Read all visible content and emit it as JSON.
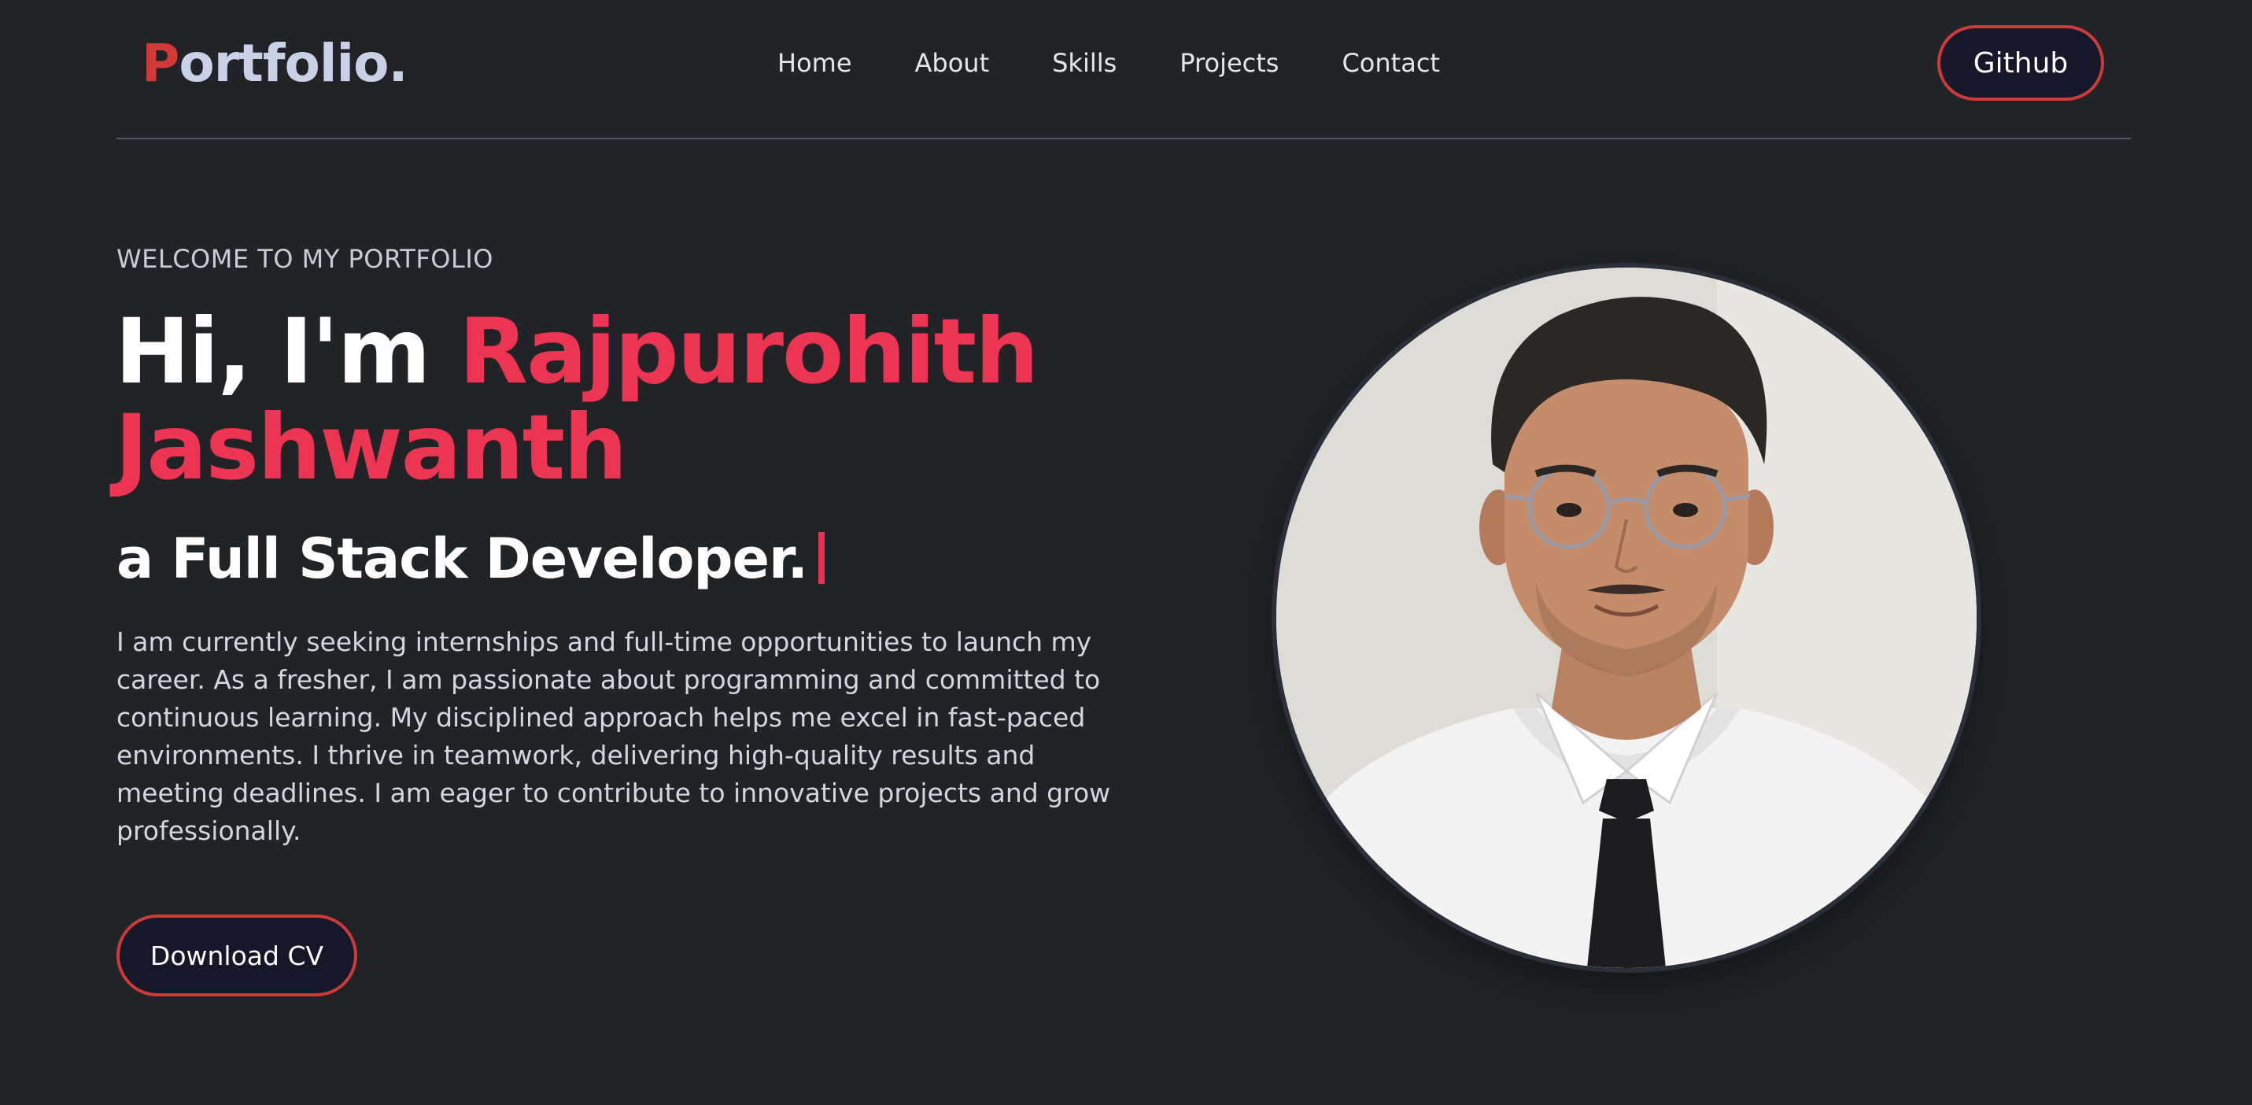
{
  "header": {
    "logo_initial": "P",
    "logo_rest": "ortfolio.",
    "nav": [
      {
        "label": "Home"
      },
      {
        "label": "About"
      },
      {
        "label": "Skills"
      },
      {
        "label": "Projects"
      },
      {
        "label": "Contact"
      }
    ],
    "github_label": "Github"
  },
  "hero": {
    "welcome": "WELCOME TO MY PORTFOLIO",
    "greeting": "Hi, I'm ",
    "name": "Rajpurohith Jashwanth",
    "role": "a Full Stack Developer.",
    "bio": "I am currently seeking internships and full-time opportunities to launch my career. As a fresher, I am passionate about programming and committed to continuous learning. My disciplined approach helps me excel in fast-paced environments. I thrive in teamwork, delivering high-quality results and meeting deadlines. I am eager to contribute to innovative projects and grow professionally.",
    "download_label": "Download CV"
  },
  "colors": {
    "background": "#222327",
    "accent": "#ec3552",
    "button_border": "#cc3a3a",
    "button_fill": "#161729"
  },
  "icons": {
    "profile_photo": "profile-photo"
  }
}
